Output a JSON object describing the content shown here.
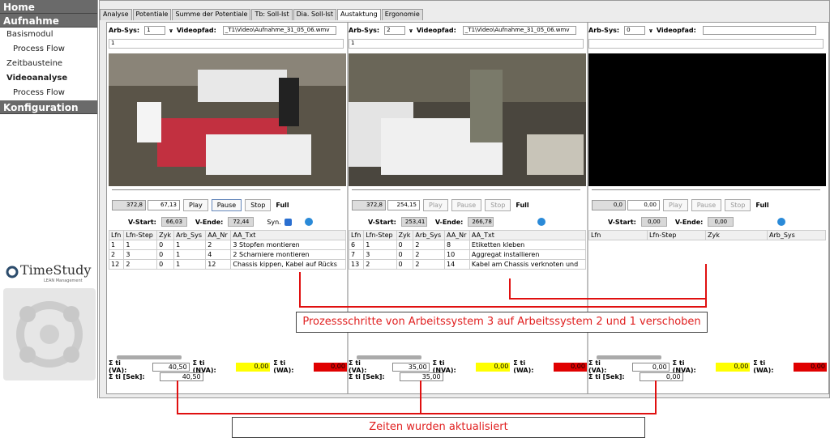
{
  "sidebar": {
    "home": "Home",
    "aufnahme": "Aufnahme",
    "basismodul": "Basismodul",
    "process_flow_1": "Process Flow",
    "zeitbausteine": "Zeitbausteine",
    "videoanalyse": "Videoanalyse",
    "process_flow_2": "Process Flow",
    "konfiguration": "Konfiguration",
    "logo_text": "TimeStudy",
    "logo_sub": "LEAN Management"
  },
  "tabs": [
    "Analyse",
    "Potentiale",
    "Summe der Potentiale",
    "Tb: Soll-Ist",
    "Dia. Soll-Ist",
    "Austaktung",
    "Ergonomie"
  ],
  "labels": {
    "arbsys": "Arb-Sys:",
    "videopfad": "Videopfad:",
    "play": "Play",
    "pause": "Pause",
    "stop": "Stop",
    "full": "Full",
    "vstart": "V-Start:",
    "vende": "V-Ende:",
    "syn": "Syn.",
    "ti_va": "Σ ti (VA):",
    "ti_nva": "Σ ti (NVA):",
    "ti_wa": "Σ ti (WA):",
    "ti_sek": "Σ ti [Sek]:"
  },
  "pane1": {
    "arbsys": "1",
    "path": "_T1\\Video\\Aufnahme_31_05_06.wmv",
    "num": "1",
    "pos": "372,8",
    "cur": "67,13",
    "vstart": "66,03",
    "vende": "72,44",
    "cols": [
      "Lfn",
      "Lfn-Step",
      "Zyk",
      "Arb_Sys",
      "AA_Nr",
      "AA_Txt"
    ],
    "rows": [
      [
        "1",
        "1",
        "0",
        "1",
        "2",
        "3 Stopfen montieren"
      ],
      [
        "2",
        "3",
        "0",
        "1",
        "4",
        "2 Scharniere montieren"
      ],
      [
        "12",
        "2",
        "0",
        "1",
        "12",
        "Chassis kippen, Kabel auf Rücks"
      ]
    ],
    "va": "40,50",
    "nva": "0,00",
    "wa": "0,00",
    "sek": "40,50"
  },
  "pane2": {
    "arbsys": "2",
    "path": "_T1\\Video\\Aufnahme_31_05_06.wmv",
    "num": "1",
    "pos": "372,8",
    "cur": "254,15",
    "vstart": "253,41",
    "vende": "266,78",
    "cols": [
      "Lfn",
      "Lfn-Step",
      "Zyk",
      "Arb_Sys",
      "AA_Nr",
      "AA_Txt"
    ],
    "rows": [
      [
        "6",
        "1",
        "0",
        "2",
        "8",
        "Etiketten kleben"
      ],
      [
        "7",
        "3",
        "0",
        "2",
        "10",
        "Aggregat installieren"
      ],
      [
        "13",
        "2",
        "0",
        "2",
        "14",
        "Kabel am Chassis verknoten und"
      ]
    ],
    "va": "35,00",
    "nva": "0,00",
    "wa": "0,00",
    "sek": "35,00"
  },
  "pane3": {
    "arbsys": "0",
    "path": "",
    "num": "",
    "pos": "0,0",
    "cur": "0,00",
    "vstart": "0,00",
    "vende": "0,00",
    "cols": [
      "Lfn",
      "Lfn-Step",
      "Zyk",
      "Arb_Sys"
    ],
    "va": "0,00",
    "nva": "0,00",
    "wa": "0,00",
    "sek": "0,00"
  },
  "callouts": {
    "moved": "Prozessschritte von Arbeitssystem 3 auf Arbeitssystem 2 und 1 verschoben",
    "updated": "Zeiten wurden aktualisiert"
  }
}
